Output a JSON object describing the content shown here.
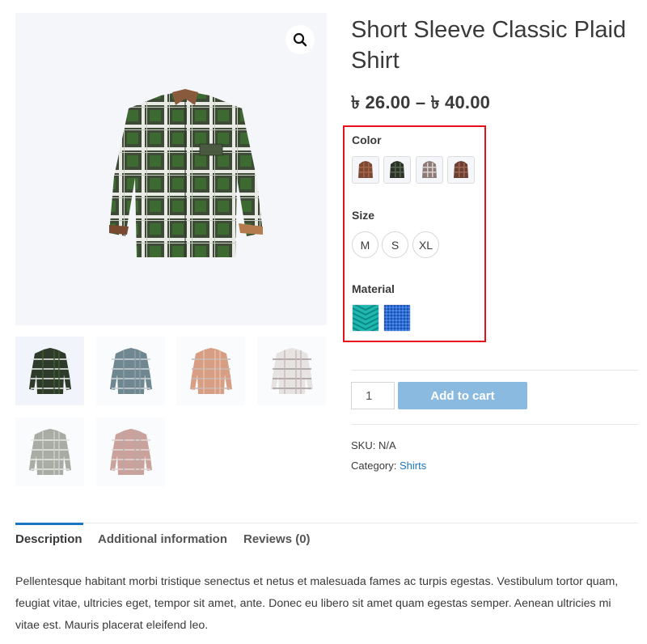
{
  "product": {
    "title": "Short Sleeve Classic Plaid Shirt",
    "price_range": "৳ 26.00 – ৳ 40.00",
    "sku_label": "SKU:",
    "sku_value": "N/A",
    "category_label": "Category:",
    "category_value": "Shirts"
  },
  "gallery": {
    "zoom_icon": "search-icon",
    "thumbnails": [
      {
        "name": "green-plaid",
        "colors": [
          "#2e3a2a",
          "#3f5c33",
          "#e8e8e8"
        ]
      },
      {
        "name": "blue-grey",
        "colors": [
          "#6f8790",
          "#8ea0a6",
          "#c7cfd2"
        ]
      },
      {
        "name": "orange-plaid",
        "colors": [
          "#d79e84",
          "#e7c1ad",
          "#c8b8b4"
        ]
      },
      {
        "name": "white-plaid",
        "colors": [
          "#e7e3e3",
          "#c9b9b6",
          "#a89e9e"
        ]
      },
      {
        "name": "grey-plaid",
        "colors": [
          "#a9aca5",
          "#cfd1cb",
          "#e3e3e0"
        ]
      },
      {
        "name": "rose-plaid",
        "colors": [
          "#caa29b",
          "#b8a8a6",
          "#e0d6d4"
        ]
      }
    ]
  },
  "variations": {
    "color": {
      "label": "Color",
      "options": [
        {
          "name": "brown-plaid",
          "colors": [
            "#7c4a33",
            "#a7644a"
          ]
        },
        {
          "name": "dark-green-plaid",
          "colors": [
            "#2b3326",
            "#58664f"
          ]
        },
        {
          "name": "white-grey-plaid",
          "colors": [
            "#8e7a78",
            "#dad2d1"
          ]
        },
        {
          "name": "rust-plaid",
          "colors": [
            "#6d3f33",
            "#9d6553"
          ]
        }
      ]
    },
    "size": {
      "label": "Size",
      "options": [
        "M",
        "S",
        "XL"
      ]
    },
    "material": {
      "label": "Material",
      "options": [
        {
          "name": "teal-chevron",
          "colors": [
            "#1fb8b0",
            "#0d8a85"
          ]
        },
        {
          "name": "blue-weave",
          "colors": [
            "#2f6fd6",
            "#1d4fae"
          ]
        }
      ]
    }
  },
  "cart": {
    "quantity": "1",
    "add_to_cart_label": "Add to cart"
  },
  "tabs": [
    {
      "label": "Description",
      "active": true
    },
    {
      "label": "Additional information",
      "active": false
    },
    {
      "label": "Reviews (0)",
      "active": false
    }
  ],
  "description": "Pellentesque habitant morbi tristique senectus et netus et malesuada fames ac turpis egestas. Vestibulum tortor quam, feugiat vitae, ultricies eget, tempor sit amet, ante. Donec eu libero sit amet quam egestas semper. Aenean ultricies mi vitae est. Mauris placerat eleifend leo.",
  "colors": {
    "accent": "#1a76c2",
    "button": "#8bbae0",
    "highlight_border": "#e8101a"
  }
}
